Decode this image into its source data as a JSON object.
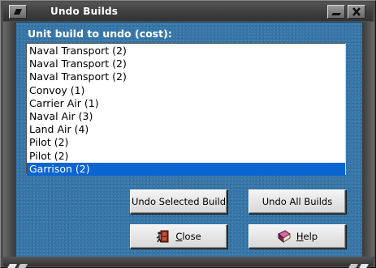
{
  "window": {
    "title": "Undo Builds"
  },
  "list": {
    "label": "Unit build to undo (cost):",
    "items": [
      "Naval Transport (2)",
      "Naval Transport (2)",
      "Naval Transport (2)",
      "Convoy (1)",
      "Carrier Air (1)",
      "Naval Air (3)",
      "Land Air (4)",
      "Pilot (2)",
      "Pilot (2)",
      "Garrison (2)"
    ],
    "selected_index": 9
  },
  "buttons": {
    "undo_selected": "Undo Selected Build",
    "undo_all": "Undo All Builds",
    "close_first": "C",
    "close_rest": "lose",
    "help_first": "H",
    "help_rest": "elp"
  },
  "icons": {
    "close_button_icon": "door-exit-icon",
    "help_button_icon": "book-icon",
    "titlebar_left": "restore-icon",
    "titlebar_min": "minimize-icon",
    "titlebar_close": "close-x-icon"
  },
  "colors": {
    "panel_blue": "#3676a8",
    "selection": "#0a64d2"
  }
}
